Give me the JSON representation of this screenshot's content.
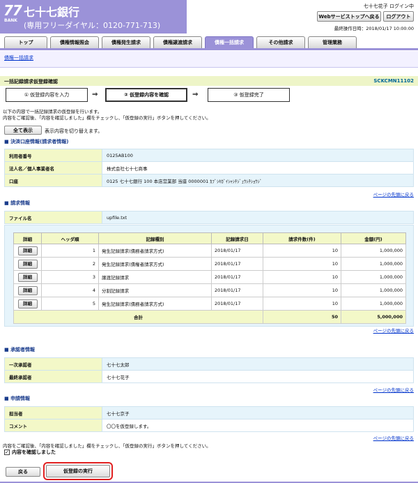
{
  "header": {
    "logo_num": "77",
    "logo_bank": "BANK",
    "bank_name": "七十七銀行",
    "tel": "(専用フリーダイヤル：0120-771-713)",
    "user": "七十七花子 ログイン中",
    "web_button": "Webサービストップへ戻る",
    "logout_button": "ログアウト",
    "last_op": "最終操作日時：2018/01/17 10:00:00"
  },
  "tabs": [
    "トップ",
    "債権情報照会",
    "債権発生請求",
    "債権譲渡請求",
    "債権一括請求",
    "その他請求",
    "管理業務"
  ],
  "subnav": "債権一括請求",
  "title": "一括記録請求仮登録確認",
  "screen_id": "SCKCMN11102",
  "steps": [
    "① 仮登録内容を入力",
    "② 仮登録内容を確認",
    "③ 仮登録完了"
  ],
  "arrow": "⇒",
  "message": {
    "line1": "以下の内容で一括記録請求の仮登録を行います。",
    "line2": "内容をご確認後、「内容を確認しました」欄をチェックし、「仮登録の実行」ボタンを押してください。"
  },
  "show_all_button": "全て表示",
  "show_all_note": "表示内容を切り替えます。",
  "sections": {
    "account": "決済口座情報(請求者情報)",
    "request": "請求情報",
    "approver": "承認者情報",
    "applicant": "申請情報"
  },
  "account": [
    {
      "k": "利用者番号",
      "v": "0125AB100"
    },
    {
      "k": "法人名／個人事業者名",
      "v": "株式会社七十七商事"
    },
    {
      "k": "口座",
      "v": "0125 七十七銀行 100 本店営業部 当座 0000001 ｶﾌﾞｼｷｶﾞｲｼｬｼﾁｼﾞｭｳｼﾁｼｮｳｼﾞ"
    }
  ],
  "page_top_link": "ページの先頭に戻る",
  "file": {
    "k": "ファイル名",
    "v": "upfile.txt"
  },
  "detail": {
    "headers": [
      "詳細",
      "ヘッダ順",
      "記録種別",
      "記録請求日",
      "請求件数(件)",
      "金額(円)"
    ],
    "button": "詳細",
    "rows": [
      {
        "order": "1",
        "type": "発生記録請求(債務者請求方式)",
        "date": "2018/01/17",
        "count": "10",
        "amount": "1,000,000"
      },
      {
        "order": "2",
        "type": "発生記録請求(債権者請求方式)",
        "date": "2018/01/17",
        "count": "10",
        "amount": "1,000,000"
      },
      {
        "order": "3",
        "type": "譲渡記録請求",
        "date": "2018/01/17",
        "count": "10",
        "amount": "1,000,000"
      },
      {
        "order": "4",
        "type": "分割記録請求",
        "date": "2018/01/17",
        "count": "10",
        "amount": "1,000,000"
      },
      {
        "order": "5",
        "type": "発生記録請求(債務者請求方式)",
        "date": "2018/01/17",
        "count": "10",
        "amount": "1,000,000"
      }
    ],
    "total_label": "合計",
    "total_count": "50",
    "total_amount": "5,000,000"
  },
  "approver": [
    {
      "k": "一次承認者",
      "v": "七十七太郎"
    },
    {
      "k": "最終承認者",
      "v": "七十七花子"
    }
  ],
  "applicant": [
    {
      "k": "担当者",
      "v": "七十七京子"
    },
    {
      "k": "コメント",
      "v": "〇〇を仮登録します。"
    }
  ],
  "confirm_msg": "内容をご確認後、「内容を確認しました」欄をチェックし、「仮登録の実行」ボタンを押してください。",
  "confirm_check": "内容を確認しました",
  "back_button": "戻る",
  "exec_button": "仮登録の実行",
  "colors": {
    "accent": "#9b92d8",
    "title_bg": "#eef5c8",
    "highlight": "#e02020"
  }
}
